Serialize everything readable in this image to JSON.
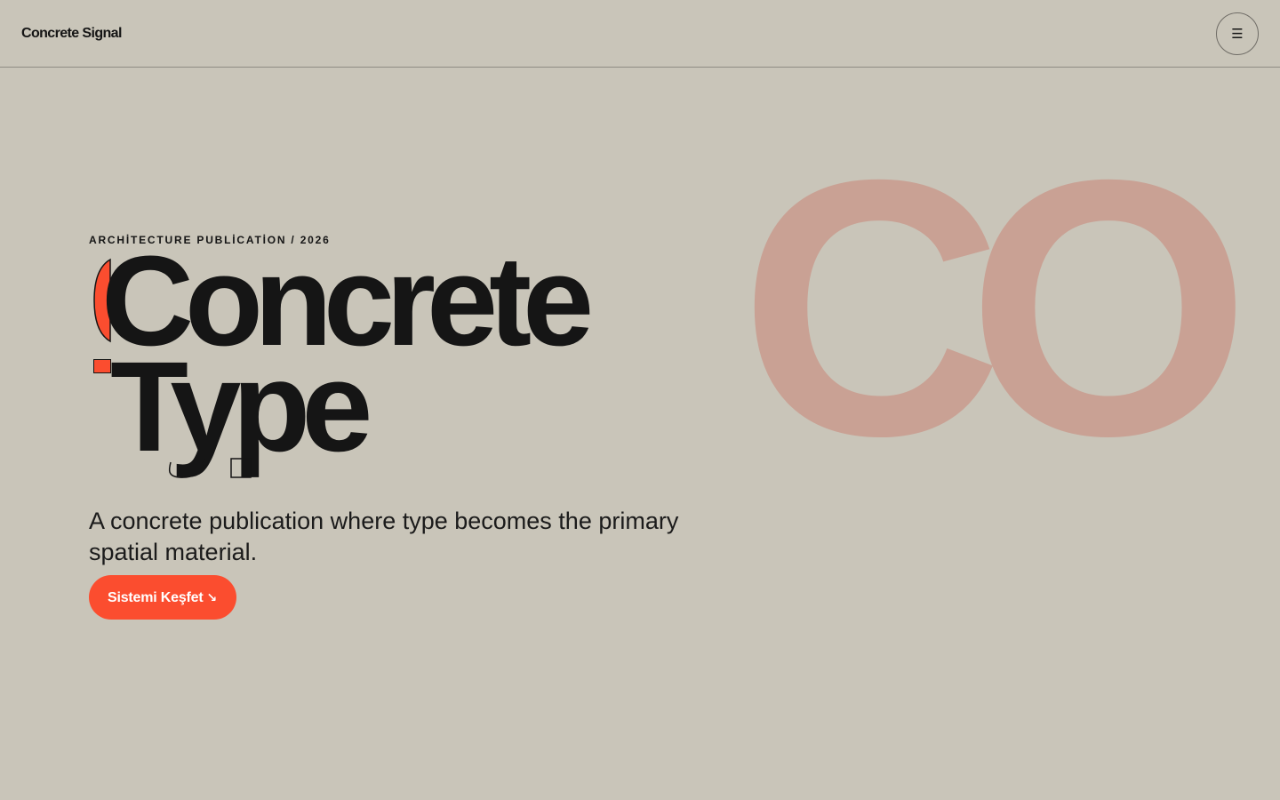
{
  "header": {
    "brand": "Concrete Signal",
    "menu_icon": "hamburger-icon",
    "menu_glyph": "☰"
  },
  "hero": {
    "eyebrow": "ARCHİTECTURE PUBLİCATİON / 2026",
    "title_line_1": "Concrete",
    "title_line_2": "Type",
    "subtitle": "A concrete publication where type becomes the primary spatial material.",
    "cta_label": "Sistemi Keşfet",
    "cta_icon": "arrow-down-right-icon",
    "cta_glyph": "↘"
  },
  "decor": {
    "background_letters": "CO",
    "background_color": "#c9c5b9",
    "letter_color": "#c9a194",
    "accent_color": "#fb4d2f",
    "text_color": "#151515"
  }
}
